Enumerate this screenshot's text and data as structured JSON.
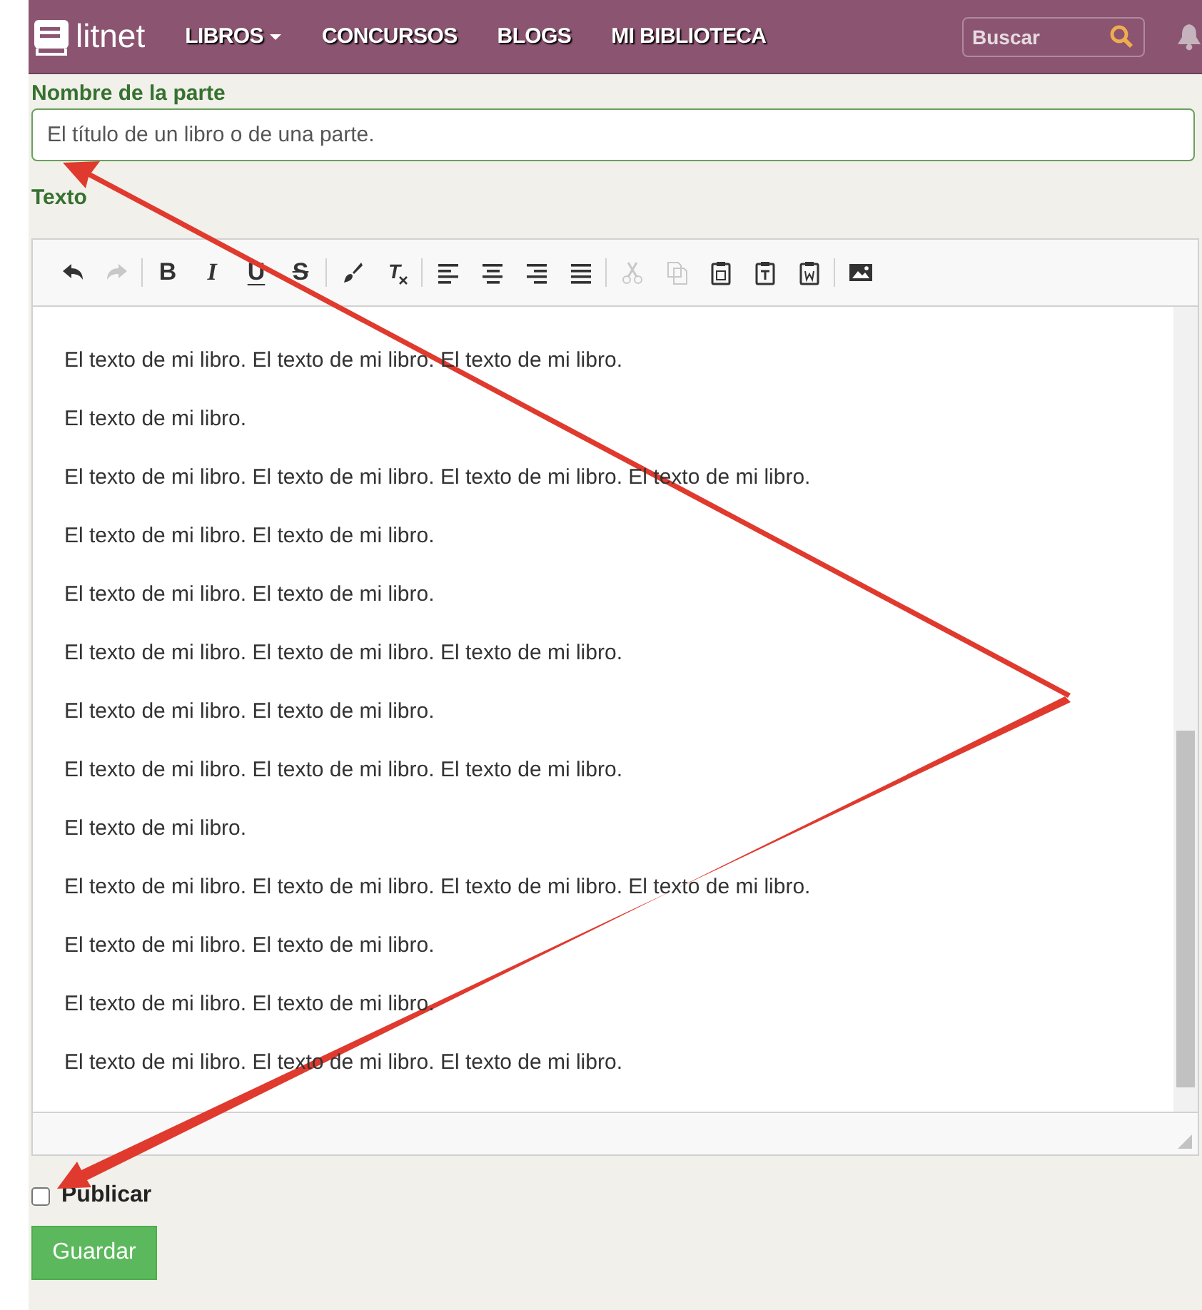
{
  "navbar": {
    "logo": "litnet",
    "menu": [
      {
        "label": "LIBROS",
        "dropdown": true
      },
      {
        "label": "CONCURSOS",
        "dropdown": false
      },
      {
        "label": "BLOGS",
        "dropdown": false
      },
      {
        "label": "MI BIBLIOTECA",
        "dropdown": false
      }
    ],
    "search": {
      "placeholder": "Buscar"
    }
  },
  "part_name": {
    "label": "Nombre de la parte",
    "placeholder": "El título de un libro o de una parte."
  },
  "text_label": "Texto",
  "toolbar": [
    {
      "kind": "undo",
      "disabled": false
    },
    {
      "kind": "redo",
      "disabled": true
    },
    {
      "kind": "sep"
    },
    {
      "kind": "bold",
      "label": "B",
      "disabled": false
    },
    {
      "kind": "italic",
      "label": "I",
      "disabled": false
    },
    {
      "kind": "underline",
      "label": "U",
      "disabled": false
    },
    {
      "kind": "strike",
      "label": "S",
      "disabled": false
    },
    {
      "kind": "sep"
    },
    {
      "kind": "brush",
      "disabled": false
    },
    {
      "kind": "clear",
      "label": "T",
      "disabled": false
    },
    {
      "kind": "sep"
    },
    {
      "kind": "left",
      "disabled": false
    },
    {
      "kind": "center",
      "disabled": false
    },
    {
      "kind": "right",
      "disabled": false
    },
    {
      "kind": "justify",
      "disabled": false
    },
    {
      "kind": "sep"
    },
    {
      "kind": "cut",
      "disabled": true
    },
    {
      "kind": "copy",
      "disabled": true
    },
    {
      "kind": "paste",
      "disabled": false
    },
    {
      "kind": "paste-text",
      "disabled": false
    },
    {
      "kind": "paste-word",
      "disabled": false
    },
    {
      "kind": "sep"
    },
    {
      "kind": "image",
      "disabled": false
    }
  ],
  "paragraphs": [
    "El texto de mi libro. El texto de mi libro. El texto de mi libro.",
    "El texto de mi libro.",
    "El texto de mi libro. El texto de mi libro. El texto de mi libro. El texto de mi libro.",
    "El texto de mi libro. El texto de mi libro.",
    "El texto de mi libro. El texto de mi libro.",
    "El texto de mi libro. El texto de mi libro. El texto de mi libro.",
    "El texto de mi libro. El texto de mi libro.",
    "El texto de mi libro. El texto de mi libro. El texto de mi libro.",
    "El texto de mi libro.",
    "El texto de mi libro. El texto de mi libro. El texto de mi libro. El texto de mi libro.",
    "El texto de mi libro. El texto de mi libro.",
    "El texto de mi libro. El texto de mi libro.",
    "El texto de mi libro. El texto de mi libro. El texto de mi libro."
  ],
  "publish": {
    "label": "Publicar",
    "checked": false
  },
  "save_button": "Guardar"
}
